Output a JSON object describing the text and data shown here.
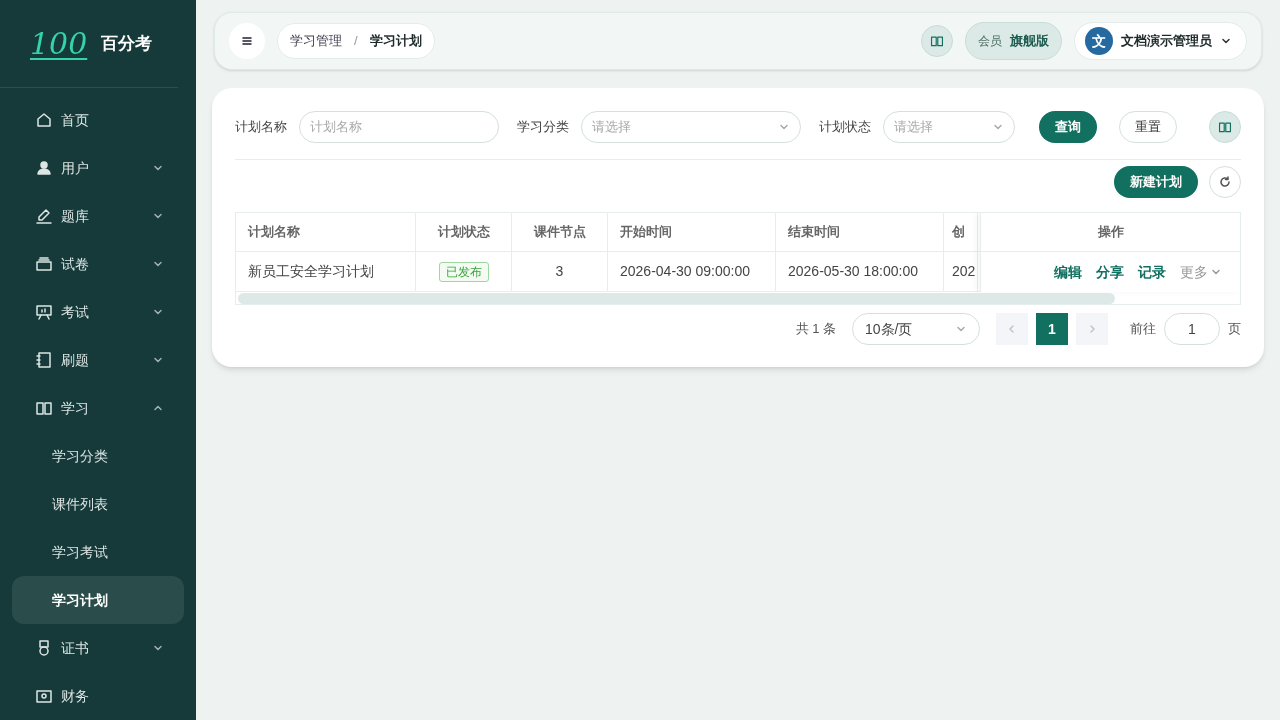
{
  "sidebar": {
    "brand": {
      "logo": "100",
      "name": "百分考"
    },
    "items": [
      {
        "label": "首页"
      },
      {
        "label": "用户",
        "expanded": false
      },
      {
        "label": "题库",
        "expanded": false
      },
      {
        "label": "试卷",
        "expanded": false
      },
      {
        "label": "考试",
        "expanded": false
      },
      {
        "label": "刷题",
        "expanded": false
      },
      {
        "label": "学习",
        "expanded": true,
        "children": [
          {
            "label": "学习分类",
            "selected": false
          },
          {
            "label": "课件列表",
            "selected": false
          },
          {
            "label": "学习考试",
            "selected": false
          },
          {
            "label": "学习计划",
            "selected": true
          }
        ]
      },
      {
        "label": "证书",
        "expanded": false
      },
      {
        "label": "财务"
      }
    ]
  },
  "header": {
    "breadcrumb": [
      "学习管理",
      "学习计划"
    ],
    "breadcrumb_separator": "/",
    "member_label": "会员",
    "member_tier": "旗舰版",
    "user": {
      "avatar": "文",
      "name": "文档演示管理员"
    }
  },
  "filters": [
    {
      "label": "计划名称",
      "kind": "text",
      "placeholder": "计划名称"
    },
    {
      "label": "学习分类",
      "kind": "select",
      "placeholder": "请选择"
    },
    {
      "label": "计划状态",
      "kind": "select",
      "placeholder": "请选择"
    }
  ],
  "filter_buttons": {
    "query": "查询",
    "reset": "重置"
  },
  "new_button": "新建计划",
  "table": {
    "columns": [
      "计划名称",
      "计划状态",
      "课件节点",
      "开始时间",
      "结束时间",
      "创"
    ],
    "action_column": "操作",
    "rows": [
      {
        "cells": [
          "新员工安全学习计划",
          "已发布",
          "3",
          "2026-04-30 09:00:00",
          "2026-05-30 18:00:00",
          "202"
        ],
        "actions": [
          "编辑",
          "分享",
          "记录"
        ],
        "more": "更多"
      }
    ]
  },
  "pagination": {
    "total": "共 1 条",
    "page_size": "10条/页",
    "pages": [
      {
        "label": "1",
        "selected": true
      }
    ],
    "goto_label": "前往",
    "goto_value": "1",
    "page_suffix": "页"
  }
}
